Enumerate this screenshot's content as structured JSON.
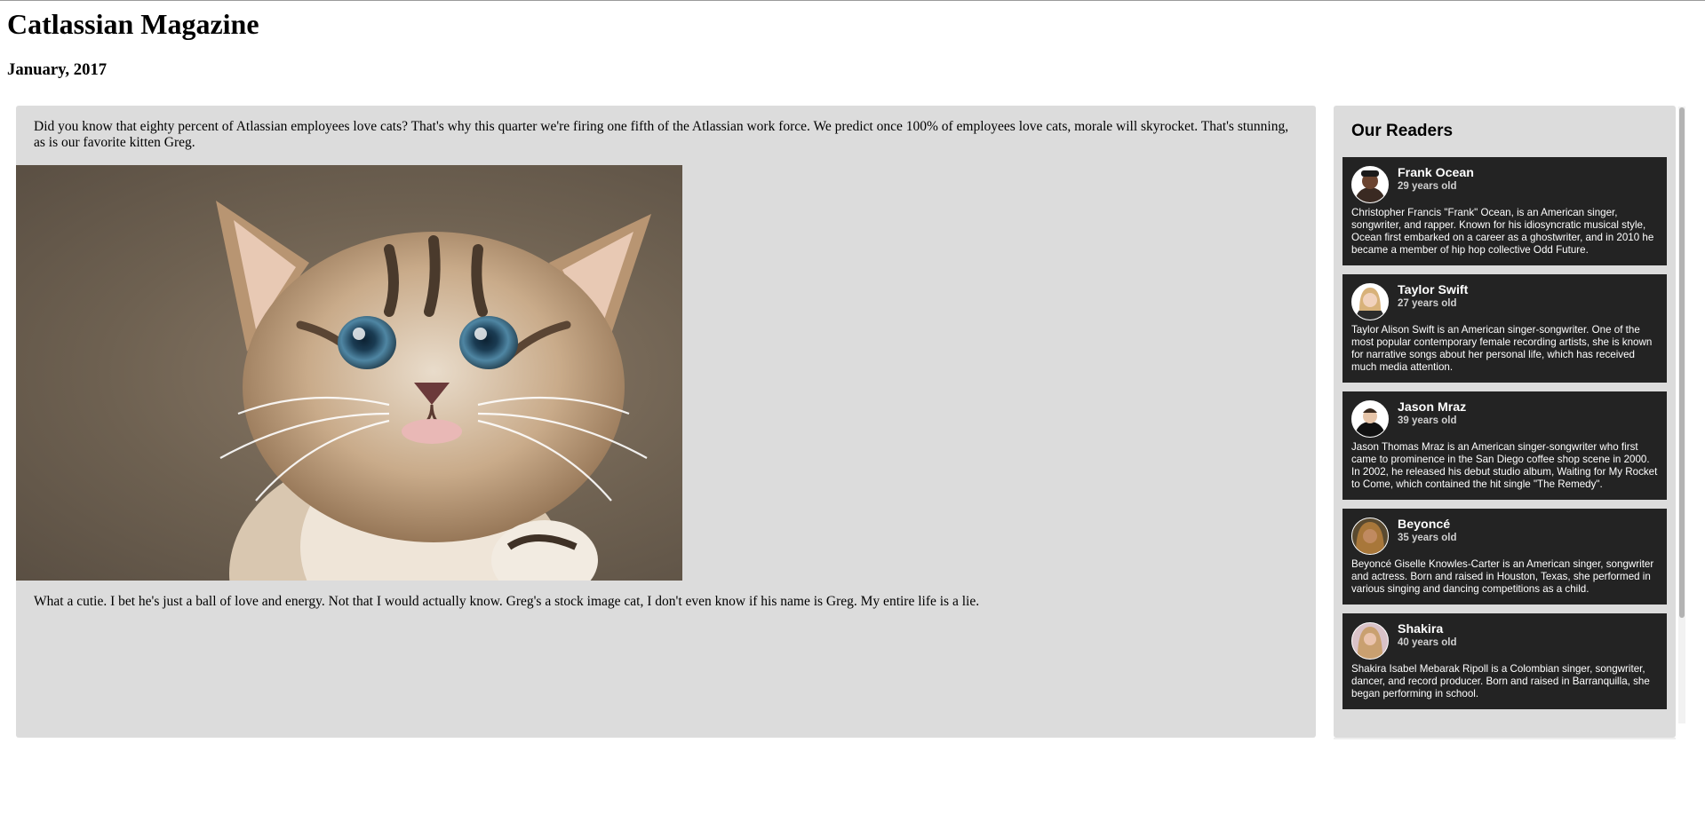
{
  "magazine": {
    "title": "Catlassian Magazine",
    "issue_date": "January, 2017"
  },
  "article": {
    "intro": "Did you know that eighty percent of Atlassian employees love cats? That's why this quarter we're firing one fifth of the Atlassian work force. We predict once 100% of employees love cats, morale will skyrocket. That's stunning, as is our favorite kitten Greg.",
    "image_description": "kitten photo",
    "outro": "What a cutie. I bet he's just a ball of love and energy. Not that I would actually know. Greg's a stock image cat, I don't even know if his name is Greg. My entire life is a lie."
  },
  "sidebar": {
    "heading": "Our Readers",
    "readers": [
      {
        "name": "Frank Ocean",
        "age": "29 years old",
        "bio": "Christopher Francis \"Frank\" Ocean, is an American singer, songwriter, and rapper. Known for his idiosyncratic musical style, Ocean first embarked on a career as a ghostwriter, and in 2010 he became a member of hip hop collective Odd Future."
      },
      {
        "name": "Taylor Swift",
        "age": "27 years old",
        "bio": "Taylor Alison Swift is an American singer-songwriter. One of the most popular contemporary female recording artists, she is known for narrative songs about her personal life, which has received much media attention."
      },
      {
        "name": "Jason Mraz",
        "age": "39 years old",
        "bio": "Jason Thomas Mraz is an American singer-songwriter who first came to prominence in the San Diego coffee shop scene in 2000. In 2002, he released his debut studio album, Waiting for My Rocket to Come, which contained the hit single \"The Remedy\"."
      },
      {
        "name": "Beyoncé",
        "age": "35 years old",
        "bio": "Beyoncé Giselle Knowles-Carter is an American singer, songwriter and actress. Born and raised in Houston, Texas, she performed in various singing and dancing competitions as a child."
      },
      {
        "name": "Shakira",
        "age": "40 years old",
        "bio": "Shakira Isabel Mebarak Ripoll is a Colombian singer, songwriter, dancer, and record producer. Born and raised in Barranquilla, she began performing in school."
      }
    ]
  },
  "colors": {
    "panel_bg": "#dcdcdc",
    "card_bg": "#232323",
    "card_text": "#ffffff"
  }
}
